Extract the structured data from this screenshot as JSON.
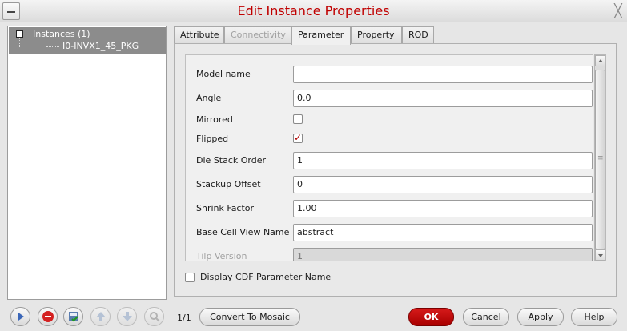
{
  "window": {
    "title": "Edit Instance Properties",
    "close_glyph": "╳"
  },
  "tree": {
    "root_label": "Instances (1)",
    "child_label": "I0-INVX1_45_PKG"
  },
  "tabs": [
    {
      "label": "Attribute",
      "state": "normal"
    },
    {
      "label": "Connectivity",
      "state": "disabled"
    },
    {
      "label": "Parameter",
      "state": "active"
    },
    {
      "label": "Property",
      "state": "normal"
    },
    {
      "label": "ROD",
      "state": "normal"
    }
  ],
  "params": {
    "model_name": {
      "label": "Model name",
      "value": ""
    },
    "angle": {
      "label": "Angle",
      "value": "0.0"
    },
    "mirrored": {
      "label": "Mirrored",
      "checked": false
    },
    "flipped": {
      "label": "Flipped",
      "checked": true
    },
    "die_stack_order": {
      "label": "Die Stack Order",
      "value": "1"
    },
    "stackup_offset": {
      "label": "Stackup Offset",
      "value": "0"
    },
    "shrink_factor": {
      "label": "Shrink Factor",
      "value": "1.00"
    },
    "base_cell_view_name": {
      "label": "Base Cell View Name",
      "value": "abstract"
    },
    "tilp_version": {
      "label": "Tilp Version",
      "value": "1"
    }
  },
  "display_cdf": {
    "label": "Display CDF Parameter Name",
    "checked": false
  },
  "footer": {
    "count": "1/1",
    "convert_label": "Convert To Mosaic",
    "ok_label": "OK",
    "cancel_label": "Cancel",
    "apply_label": "Apply",
    "help_label": "Help"
  },
  "colors": {
    "title": "#c00000",
    "ok_button": "#b80000",
    "check_mark": "#b00000",
    "tree_selection": "#8c8c8c"
  },
  "icons": [
    "play-icon",
    "stop-icon",
    "save-icon",
    "move-up-icon",
    "move-down-icon",
    "search-icon"
  ]
}
